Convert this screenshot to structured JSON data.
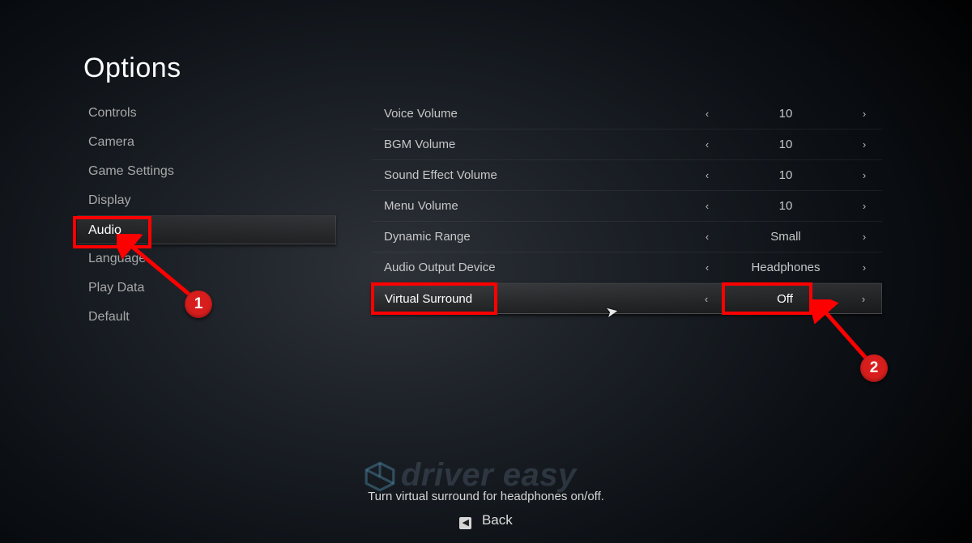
{
  "title": "Options",
  "sidebar": {
    "items": [
      {
        "label": "Controls"
      },
      {
        "label": "Camera"
      },
      {
        "label": "Game Settings"
      },
      {
        "label": "Display"
      },
      {
        "label": "Audio"
      },
      {
        "label": "Language"
      },
      {
        "label": "Play Data"
      },
      {
        "label": "Default"
      }
    ],
    "selected_index": 4
  },
  "settings": {
    "rows": [
      {
        "label": "Voice Volume",
        "value": "10"
      },
      {
        "label": "BGM Volume",
        "value": "10"
      },
      {
        "label": "Sound Effect Volume",
        "value": "10"
      },
      {
        "label": "Menu Volume",
        "value": "10"
      },
      {
        "label": "Dynamic Range",
        "value": "Small"
      },
      {
        "label": "Audio Output Device",
        "value": "Headphones"
      },
      {
        "label": "Virtual Surround",
        "value": "Off"
      }
    ],
    "selected_index": 6,
    "arrow_left_glyph": "‹",
    "arrow_right_glyph": "›"
  },
  "hint_text": "Turn virtual surround for headphones on/off.",
  "back_label": "Back",
  "watermark_text": "driver easy",
  "annotations": {
    "marker1": "1",
    "marker2": "2"
  }
}
